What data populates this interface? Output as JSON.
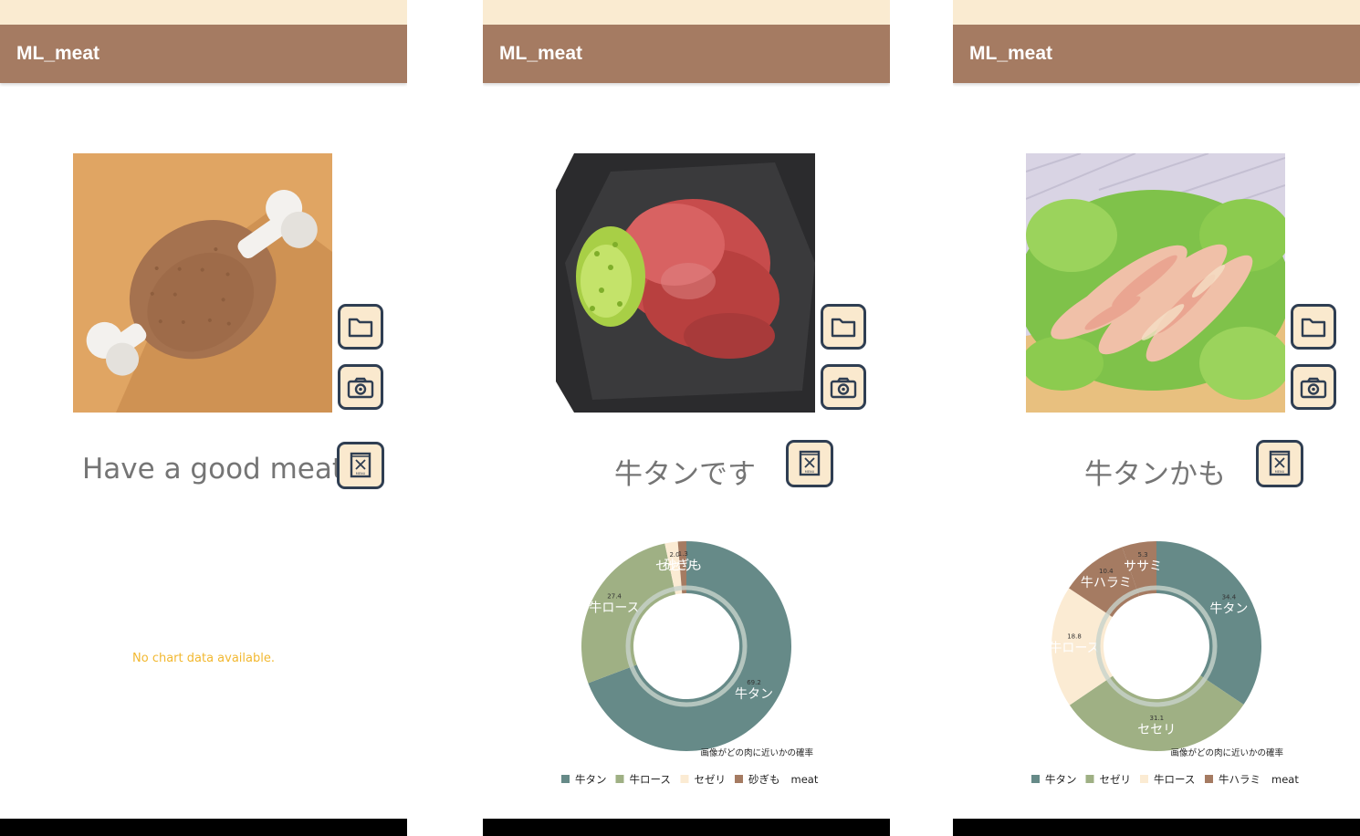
{
  "colors": {
    "statusbar": "#faebd1",
    "appbar": "#a57b62",
    "result_text": "#757575",
    "nodata": "#f2b830",
    "button_fill": "#fae9ce",
    "button_border": "#2f3e52",
    "series": [
      "#668a88",
      "#9fb084",
      "#fbebd3",
      "#a57b62"
    ]
  },
  "screens": [
    {
      "app_title": "ML_meat",
      "image": "meat-illustration",
      "result_text": "Have a good meat!",
      "nodata_text": "No chart data available.",
      "buttons": {
        "gallery_icon": "folder-icon",
        "camera_icon": "camera-icon",
        "menu_icon": "menu-icon",
        "menu_label": "MENU"
      }
    },
    {
      "app_title": "ML_meat",
      "image": "beef-tongue-photo",
      "result_text": "牛タンです",
      "buttons": {
        "gallery_icon": "folder-icon",
        "camera_icon": "camera-icon",
        "menu_icon": "menu-icon",
        "menu_label": "MENU"
      }
    },
    {
      "app_title": "ML_meat",
      "image": "chicken-neck-photo",
      "result_text": "牛タンかも",
      "buttons": {
        "gallery_icon": "folder-icon",
        "camera_icon": "camera-icon",
        "menu_icon": "menu-icon",
        "menu_label": "MENU"
      }
    }
  ],
  "chart_data": [
    {
      "type": "pie",
      "donut": true,
      "description": "画像がどの肉に近いかの確率",
      "legend_title": "meat",
      "legend_position": "bottom",
      "categories": [
        "牛タン",
        "牛ロース",
        "セゼリ",
        "砂ぎも"
      ],
      "values": [
        69.2,
        27.4,
        2.0,
        1.3
      ],
      "value_labels": [
        "69.2",
        "27.4",
        "2.0",
        "1.3"
      ],
      "slices": [
        {
          "label": "牛タン",
          "value": 69.2,
          "value_label": "69.2"
        },
        {
          "label": "牛ロース",
          "value": 27.4,
          "value_label": "27.4"
        },
        {
          "label": "セセリ",
          "value": 2.0,
          "value_label": "2.0"
        },
        {
          "label": "砂ぎも",
          "value": 1.3,
          "value_label": "1.3"
        }
      ]
    },
    {
      "type": "pie",
      "donut": true,
      "description": "画像がどの肉に近いかの確率",
      "legend_title": "meat",
      "legend_position": "bottom",
      "slices": [
        {
          "label": "牛タン",
          "value": 34.4,
          "value_label": "34.4"
        },
        {
          "label": "セセリ",
          "value": 31.1,
          "value_label": "31.1"
        },
        {
          "label": "牛ロース",
          "value": 18.8,
          "value_label": "18.8"
        },
        {
          "label": "牛ハラミ",
          "value": 10.4,
          "value_label": "10.4"
        },
        {
          "label": "ササミ",
          "value": 5.3,
          "value_label": "5.3"
        }
      ],
      "legend_items": [
        "牛タン",
        "セゼリ",
        "牛ロース",
        "牛ハラミ"
      ]
    }
  ]
}
